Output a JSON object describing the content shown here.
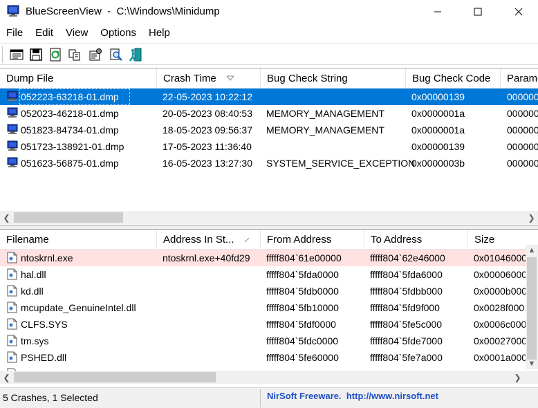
{
  "window": {
    "title": "BlueScreenView  -  C:\\Windows\\Minidump"
  },
  "menu": [
    "File",
    "Edit",
    "View",
    "Options",
    "Help"
  ],
  "toolbar": {
    "buttons": [
      "properties-icon",
      "save-icon",
      "refresh-icon",
      "copy-icon",
      "advanced-options-icon",
      "find-icon",
      "exit-icon"
    ]
  },
  "dumps": {
    "columns": [
      "Dump File",
      "Crash Time",
      "Bug Check String",
      "Bug Check Code",
      "Parame"
    ],
    "sort_indicator": "Crash Time",
    "rows": [
      {
        "file": "052223-63218-01.dmp",
        "time": "22-05-2023 10:22:12",
        "string": "",
        "code": "0x00000139",
        "param": "000000",
        "selected": true
      },
      {
        "file": "052023-46218-01.dmp",
        "time": "20-05-2023 08:40:53",
        "string": "MEMORY_MANAGEMENT",
        "code": "0x0000001a",
        "param": "000000",
        "selected": false
      },
      {
        "file": "051823-84734-01.dmp",
        "time": "18-05-2023 09:56:37",
        "string": "MEMORY_MANAGEMENT",
        "code": "0x0000001a",
        "param": "000000",
        "selected": false
      },
      {
        "file": "051723-138921-01.dmp",
        "time": "17-05-2023 11:36:40",
        "string": "",
        "code": "0x00000139",
        "param": "000000",
        "selected": false
      },
      {
        "file": "051623-56875-01.dmp",
        "time": "16-05-2023 13:27:30",
        "string": "SYSTEM_SERVICE_EXCEPTION",
        "code": "0x0000003b",
        "param": "000000",
        "selected": false
      }
    ]
  },
  "drivers": {
    "columns": [
      "Filename",
      "Address In St...",
      "From Address",
      "To Address",
      "Size"
    ],
    "rows": [
      {
        "name": "ntoskrnl.exe",
        "addr": "ntoskrnl.exe+40fd29",
        "from": "fffff804`61e00000",
        "to": "fffff804`62e46000",
        "size": "0x01046000",
        "highlight": true
      },
      {
        "name": "hal.dll",
        "addr": "",
        "from": "fffff804`5fda0000",
        "to": "fffff804`5fda6000",
        "size": "0x00006000",
        "highlight": false
      },
      {
        "name": "kd.dll",
        "addr": "",
        "from": "fffff804`5fdb0000",
        "to": "fffff804`5fdbb000",
        "size": "0x0000b000",
        "highlight": false
      },
      {
        "name": "mcupdate_GenuineIntel.dll",
        "addr": "",
        "from": "fffff804`5fb10000",
        "to": "fffff804`5fd9f000",
        "size": "0x0028f000",
        "highlight": false
      },
      {
        "name": "CLFS.SYS",
        "addr": "",
        "from": "fffff804`5fdf0000",
        "to": "fffff804`5fe5c000",
        "size": "0x0006c000",
        "highlight": false
      },
      {
        "name": "tm.sys",
        "addr": "",
        "from": "fffff804`5fdc0000",
        "to": "fffff804`5fde7000",
        "size": "0x00027000",
        "highlight": false
      },
      {
        "name": "PSHED.dll",
        "addr": "",
        "from": "fffff804`5fe60000",
        "to": "fffff804`5fe7a000",
        "size": "0x0001a000",
        "highlight": false
      }
    ]
  },
  "status": {
    "summary": "5 Crashes, 1 Selected",
    "credit": "NirSoft Freeware.  http://www.nirsoft.net"
  }
}
